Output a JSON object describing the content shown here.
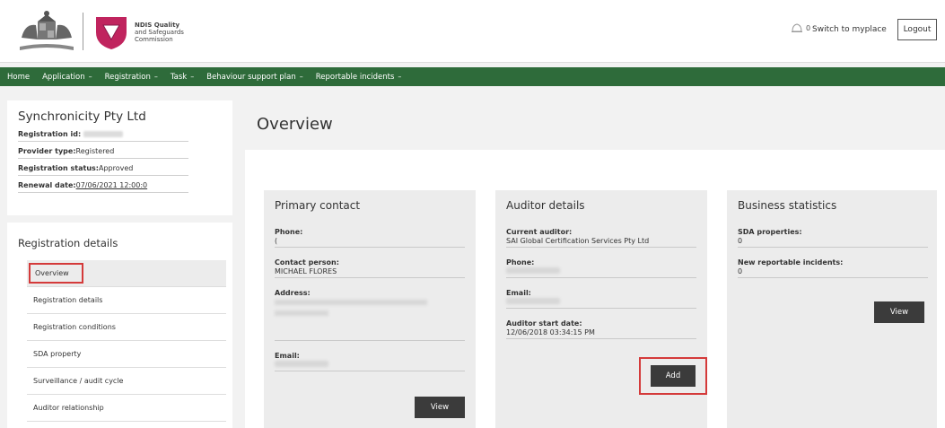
{
  "header": {
    "logo_line1": "NDIS Quality",
    "logo_line2": "and Safeguards",
    "logo_line3": "Commission",
    "notification_count": "0",
    "switch_label": "Switch to myplace",
    "logout_label": "Logout"
  },
  "nav": {
    "items": [
      {
        "label": "Home",
        "dropdown": false
      },
      {
        "label": "Application",
        "dropdown": true
      },
      {
        "label": "Registration",
        "dropdown": true
      },
      {
        "label": "Task",
        "dropdown": true
      },
      {
        "label": "Behaviour support plan",
        "dropdown": true
      },
      {
        "label": "Reportable incidents",
        "dropdown": true
      }
    ],
    "caret": "⌄",
    "bg_color": "#2e6b3a"
  },
  "org": {
    "name": "Synchronicity Pty Ltd",
    "reg_id_label": "Registration id:",
    "provider_type_label": "Provider type:",
    "provider_type_value": "Registered",
    "reg_status_label": "Registration status:",
    "reg_status_value": "Approved",
    "renewal_label": "Renewal date:",
    "renewal_value": "07/06/2021 12:00:0"
  },
  "sidebar": {
    "heading": "Registration details",
    "items": [
      {
        "label": "Overview",
        "active": true
      },
      {
        "label": "Registration details"
      },
      {
        "label": "Registration conditions"
      },
      {
        "label": "SDA property"
      },
      {
        "label": "Surveillance / audit cycle"
      },
      {
        "label": "Auditor relationship"
      }
    ]
  },
  "main": {
    "title": "Overview",
    "primary_contact": {
      "title": "Primary contact",
      "phone_label": "Phone:",
      "phone_value": "(",
      "contact_label": "Contact person:",
      "contact_value": "MICHAEL FLORES",
      "address_label": "Address:",
      "email_label": "Email:",
      "view_label": "View"
    },
    "auditor": {
      "title": "Auditor details",
      "current_label": "Current auditor:",
      "current_value": "SAI Global Certification Services Pty Ltd",
      "phone_label": "Phone:",
      "email_label": "Email:",
      "start_label": "Auditor start date:",
      "start_value": "12/06/2018 03:34:15 PM",
      "add_label": "Add"
    },
    "stats": {
      "title": "Business statistics",
      "sda_label": "SDA properties:",
      "sda_value": "0",
      "incidents_label": "New reportable incidents:",
      "incidents_value": "0",
      "view_label": "View"
    }
  },
  "icons": {
    "crest": "coat-of-arms-icon",
    "shield": "ndis-shield-icon",
    "bell": "bell-icon"
  },
  "colors": {
    "highlight": "#d43a3a",
    "button": "#3b3b3b",
    "shield": "#c0245e"
  }
}
